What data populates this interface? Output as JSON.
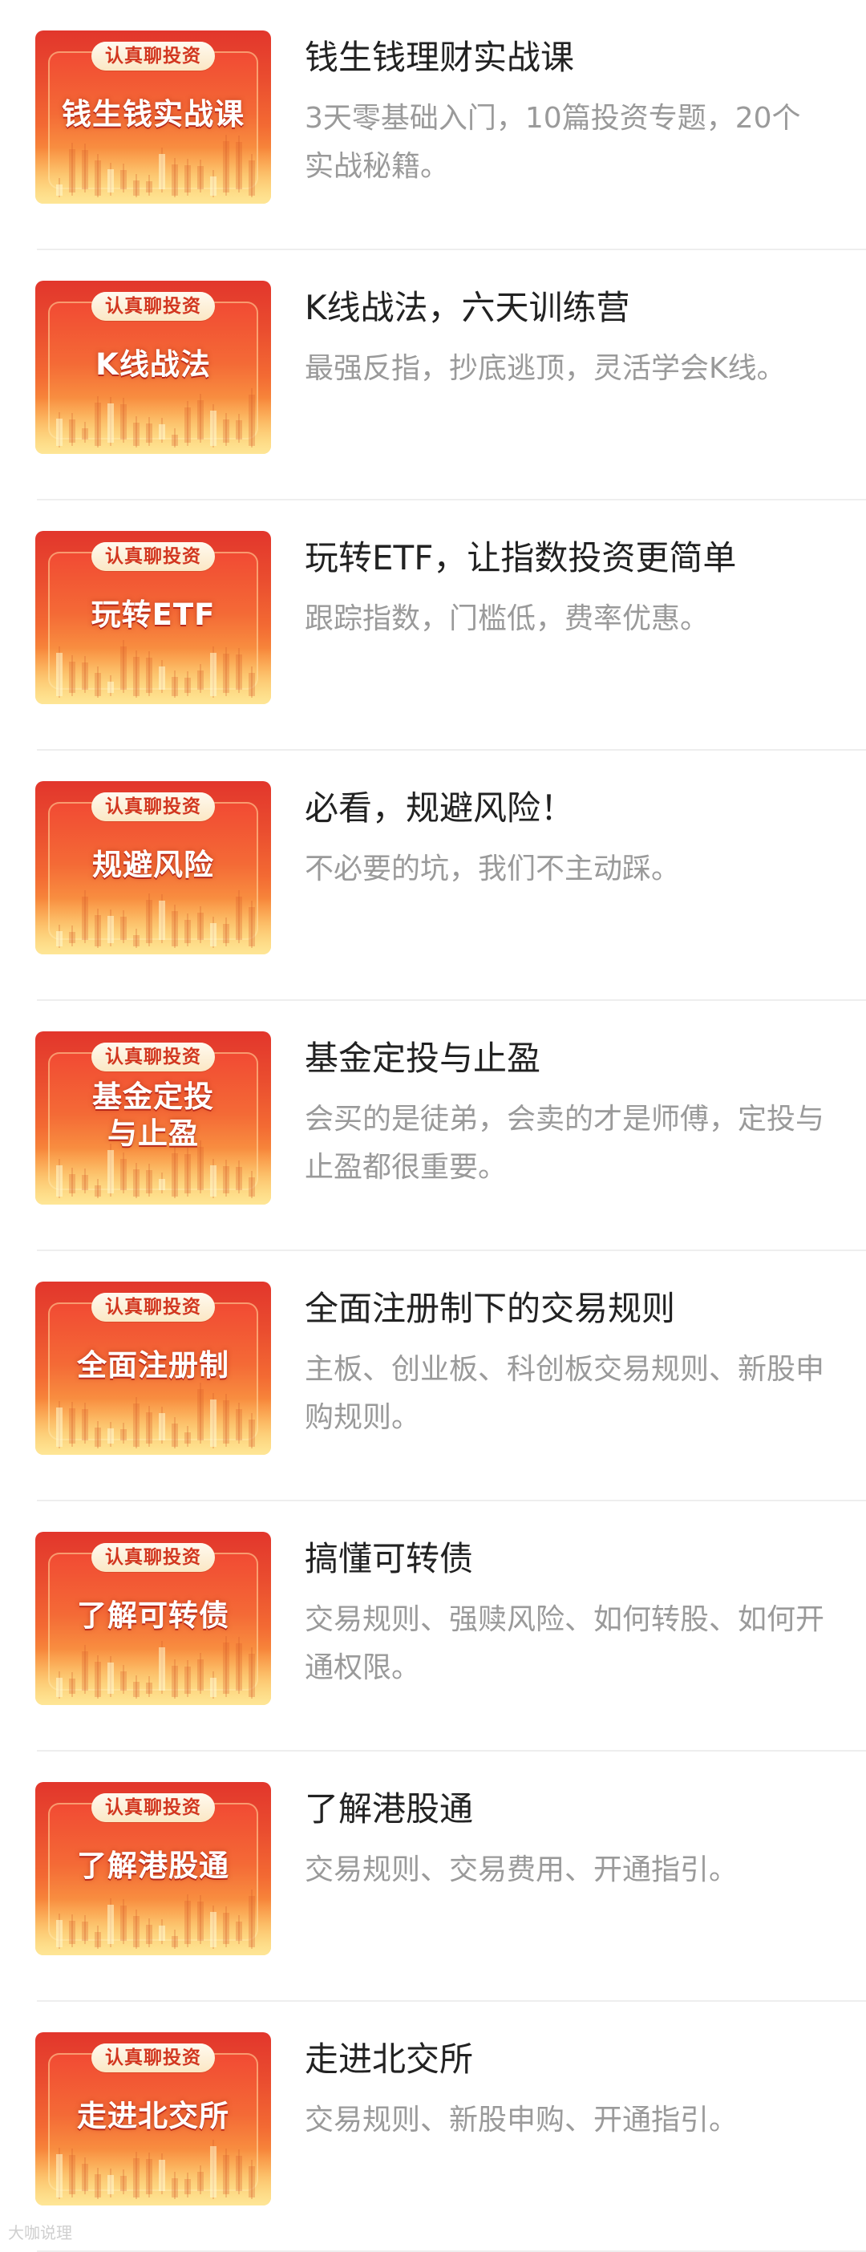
{
  "courses": [
    {
      "badge": "认真聊投资",
      "thumb_title": "钱生钱实战课",
      "title": "钱生钱理财实战课",
      "desc": "3天零基础入门，10篇投资专题，20个实战秘籍。"
    },
    {
      "badge": "认真聊投资",
      "thumb_title": "K线战法",
      "title": "K线战法，六天训练营",
      "desc": "最强反指，抄底逃顶，灵活学会K线。"
    },
    {
      "badge": "认真聊投资",
      "thumb_title": "玩转ETF",
      "title": "玩转ETF，让指数投资更简单",
      "desc": "跟踪指数，门槛低，费率优惠。"
    },
    {
      "badge": "认真聊投资",
      "thumb_title": "规避风险",
      "title": "必看，规避风险！",
      "desc": "不必要的坑，我们不主动踩。"
    },
    {
      "badge": "认真聊投资",
      "thumb_title": "基金定投与止盈",
      "title": "基金定投与止盈",
      "desc": "会买的是徒弟，会卖的才是师傅，定投与止盈都很重要。"
    },
    {
      "badge": "认真聊投资",
      "thumb_title": "全面注册制",
      "title": "全面注册制下的交易规则",
      "desc": "主板、创业板、科创板交易规则、新股申购规则。"
    },
    {
      "badge": "认真聊投资",
      "thumb_title": "了解可转债",
      "title": "搞懂可转债",
      "desc": "交易规则、强赎风险、如何转股、如何开通权限。"
    },
    {
      "badge": "认真聊投资",
      "thumb_title": "了解港股通",
      "title": "了解港股通",
      "desc": "交易规则、交易费用、开通指引。"
    },
    {
      "badge": "认真聊投资",
      "thumb_title": "走进北交所",
      "title": "走进北交所",
      "desc": "交易规则、新股申购、开通指引。"
    }
  ],
  "watermark": "大咖说理",
  "colors": {
    "title": "#222222",
    "desc": "#9a9a9a",
    "badge_text": "#d2361f",
    "divider": "#eeeeee"
  }
}
